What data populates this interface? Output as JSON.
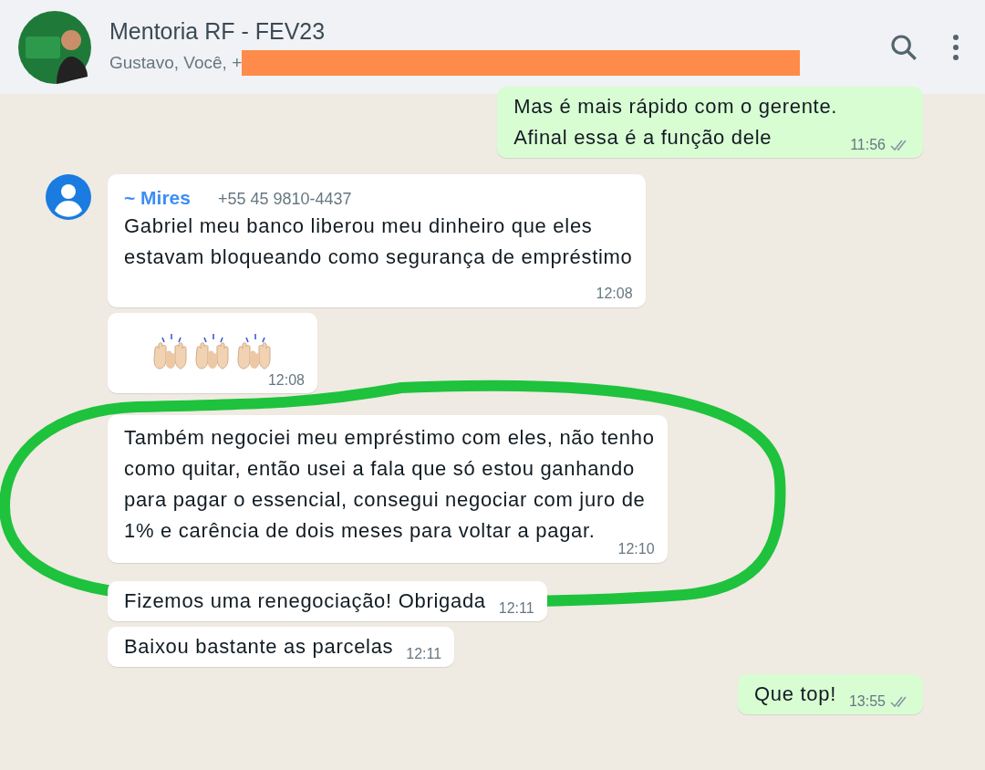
{
  "header": {
    "title": "Mentoria RF - FEV23",
    "subtitle": "Gustavo, Você, +"
  },
  "messages": [
    {
      "kind": "text",
      "outgoing": true,
      "lines": [
        "Mas é mais rápido com o gerente.",
        "Afinal essa é a função dele"
      ],
      "time": "11:56",
      "read": false
    },
    {
      "kind": "text",
      "outgoing": false,
      "first": true,
      "sender": "~ Mires",
      "phone": "+55 45 9810-4437",
      "lines": [
        "Gabriel meu banco liberou meu dinheiro que eles",
        "estavam bloqueando como segurança de empréstimo"
      ],
      "time": "12:08"
    },
    {
      "kind": "hands",
      "outgoing": false,
      "first": false,
      "time": "12:08"
    },
    {
      "kind": "text",
      "outgoing": false,
      "first": false,
      "lines": [
        "Também negociei meu empréstimo com eles, não tenho",
        "como quitar, então usei a fala que só estou ganhando",
        "para pagar o essencial, consegui negociar com juro de",
        "1% e carência de dois meses para voltar a pagar."
      ],
      "time": "12:10"
    },
    {
      "kind": "text",
      "outgoing": false,
      "first": false,
      "lines": [
        "Fizemos uma renegociação! Obrigada"
      ],
      "time": "12:11"
    },
    {
      "kind": "text",
      "outgoing": false,
      "first": false,
      "lines": [
        "Baixou bastante as parcelas"
      ],
      "time": "12:11"
    },
    {
      "kind": "text",
      "outgoing": true,
      "lines": [
        "Que top!"
      ],
      "time": "13:55",
      "read": false
    }
  ]
}
